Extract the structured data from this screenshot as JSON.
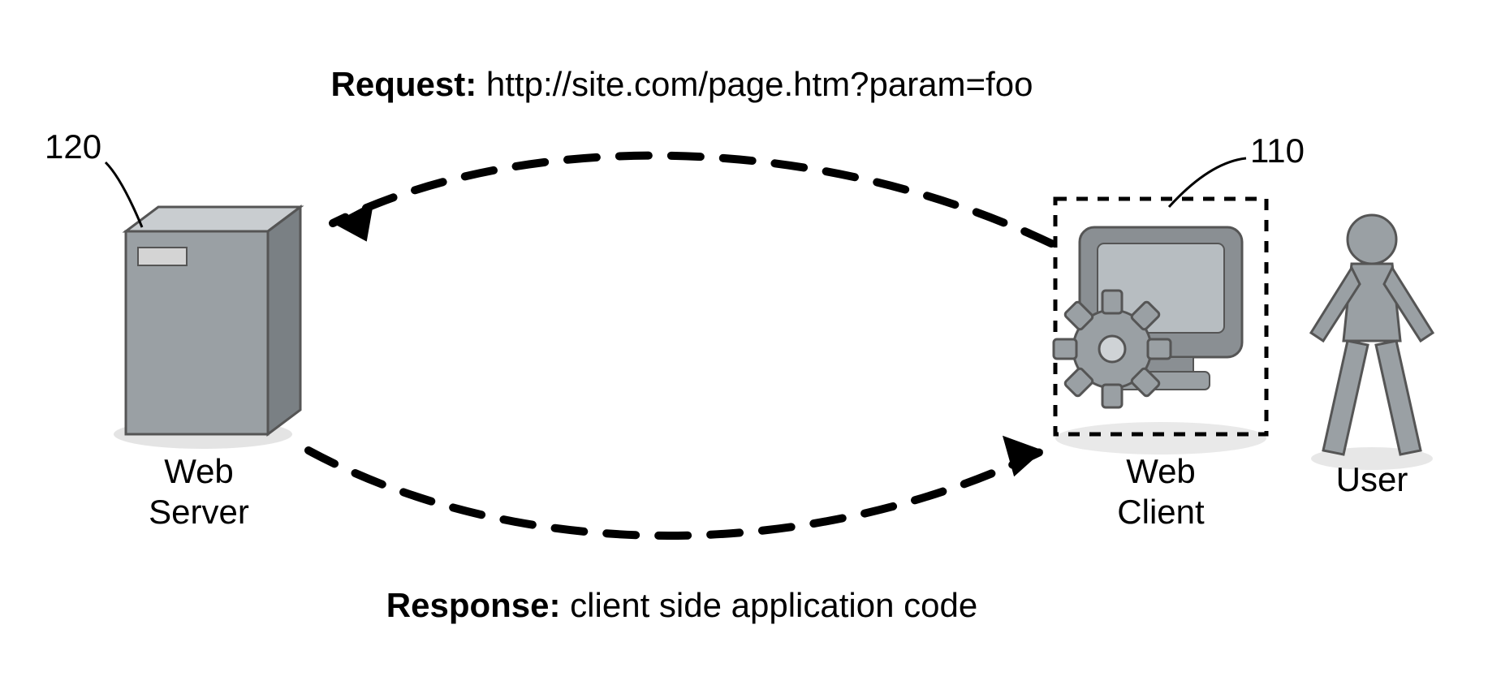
{
  "request": {
    "label_bold": "Request:",
    "label_rest": " http://site.com/page.htm?param=foo"
  },
  "response": {
    "label_bold": "Response:",
    "label_rest": " client side application code"
  },
  "server": {
    "callout": "120",
    "label_line1": "Web",
    "label_line2": "Server"
  },
  "client": {
    "callout": "110",
    "label_line1": "Web",
    "label_line2": "Client"
  },
  "user": {
    "label": "User"
  }
}
